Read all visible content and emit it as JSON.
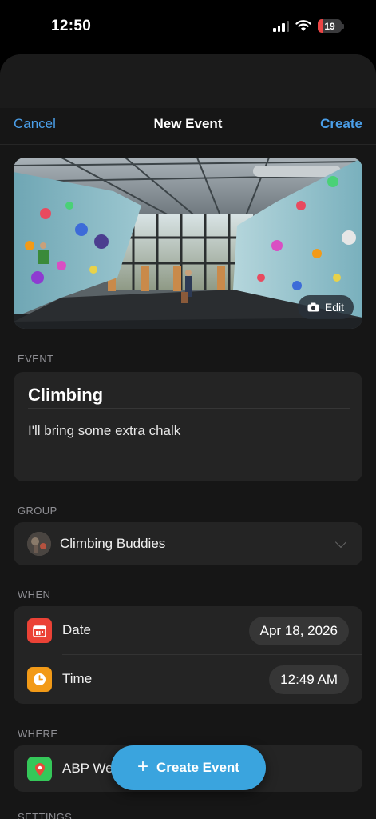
{
  "status_bar": {
    "time": "12:50",
    "battery_level": "19",
    "icons": [
      "cellular-signal-icon",
      "wifi-icon",
      "battery-icon"
    ]
  },
  "nav": {
    "cancel_label": "Cancel",
    "title": "New Event",
    "create_label": "Create"
  },
  "hero": {
    "edit_label": "Edit",
    "icons": [
      "camera-icon"
    ]
  },
  "event": {
    "section_label": "EVENT",
    "title": "Climbing",
    "description": "I'll bring some extra chalk"
  },
  "group": {
    "section_label": "GROUP",
    "selected": "Climbing Buddies",
    "icons": [
      "chevron-down-icon"
    ]
  },
  "when": {
    "section_label": "WHEN",
    "date_label": "Date",
    "date_value": "Apr 18, 2026",
    "time_label": "Time",
    "time_value": "12:49 AM",
    "icons": [
      "calendar-icon",
      "clock-icon"
    ]
  },
  "where": {
    "section_label": "WHERE",
    "location_text": "ABP We",
    "icons": [
      "map-pin-icon"
    ]
  },
  "settings": {
    "section_label": "SETTINGS"
  },
  "fab": {
    "label": "Create Event",
    "icon": "plus-icon"
  },
  "colors": {
    "accent": "#3aa4de",
    "link": "#4a9ee8",
    "date_icon": "#eb4236",
    "time_icon": "#f29a17",
    "location_icon": "#35c759",
    "background": "#161616",
    "card": "#242424"
  }
}
